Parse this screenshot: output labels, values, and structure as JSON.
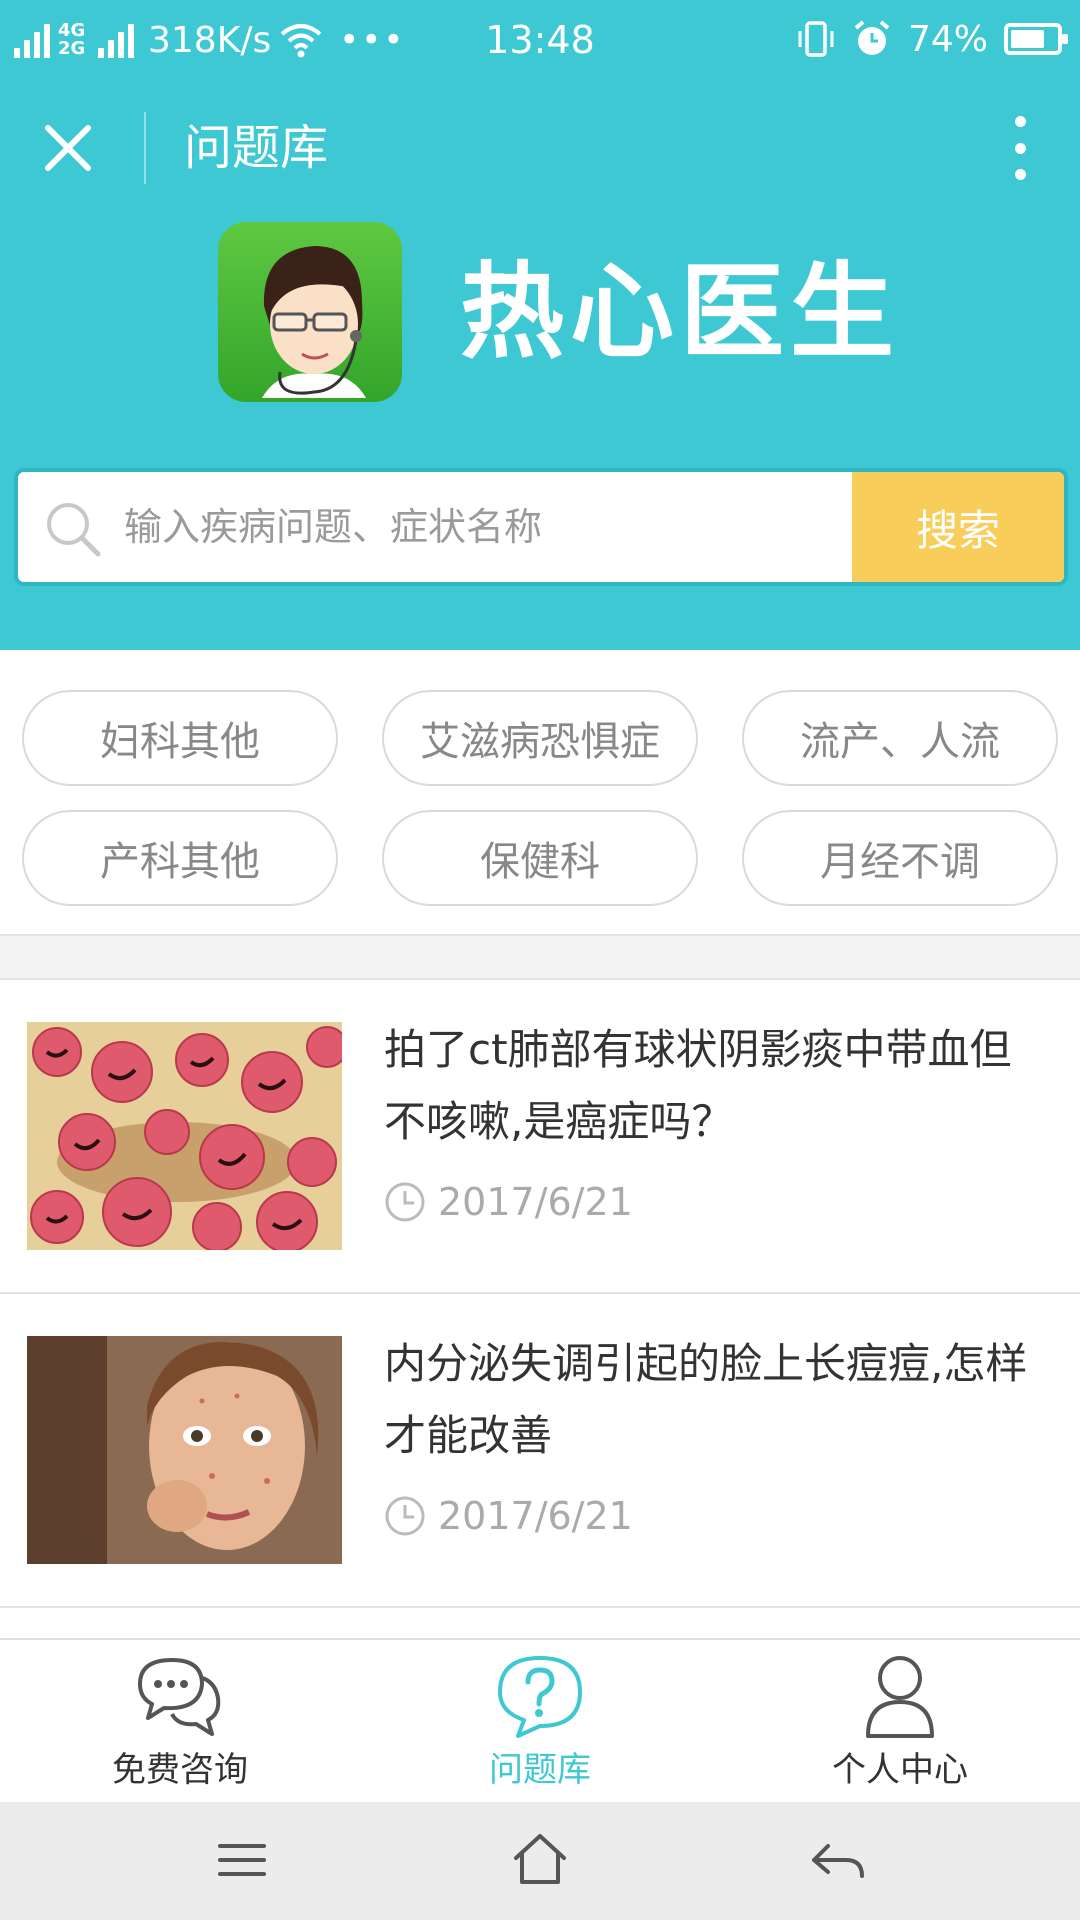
{
  "status_bar": {
    "network_top": "4G",
    "network_bottom": "2G",
    "speed": "318K/s",
    "more": "•••",
    "time": "13:48",
    "battery_level": "74%",
    "battery_fraction": 0.74
  },
  "header": {
    "title": "问题库",
    "brand_name": "热心医生"
  },
  "search": {
    "placeholder": "输入疾病问题、症状名称",
    "button_label": "搜索"
  },
  "tags": [
    "妇科其他",
    "艾滋病恐惧症",
    "流产、人流",
    "产科其他",
    "保健科",
    "月经不调"
  ],
  "articles": [
    {
      "title": "拍了ct肺部有球状阴影痰中带血但不咳嗽,是癌症吗？",
      "date": "2017/6/21"
    },
    {
      "title": "内分泌失调引起的脸上长痘痘,怎样才能改善",
      "date": "2017/6/21"
    }
  ],
  "bottom_nav": [
    {
      "label": "免费咨询",
      "icon": "chat-bubbles-icon",
      "active": false
    },
    {
      "label": "问题库",
      "icon": "question-bubble-icon",
      "active": true
    },
    {
      "label": "个人中心",
      "icon": "person-icon",
      "active": false
    }
  ],
  "colors": {
    "header_teal": "#3ec8d4",
    "search_button": "#f9cd5a",
    "logo_green": "#4cb935",
    "active_tab": "#3ec8d4"
  }
}
